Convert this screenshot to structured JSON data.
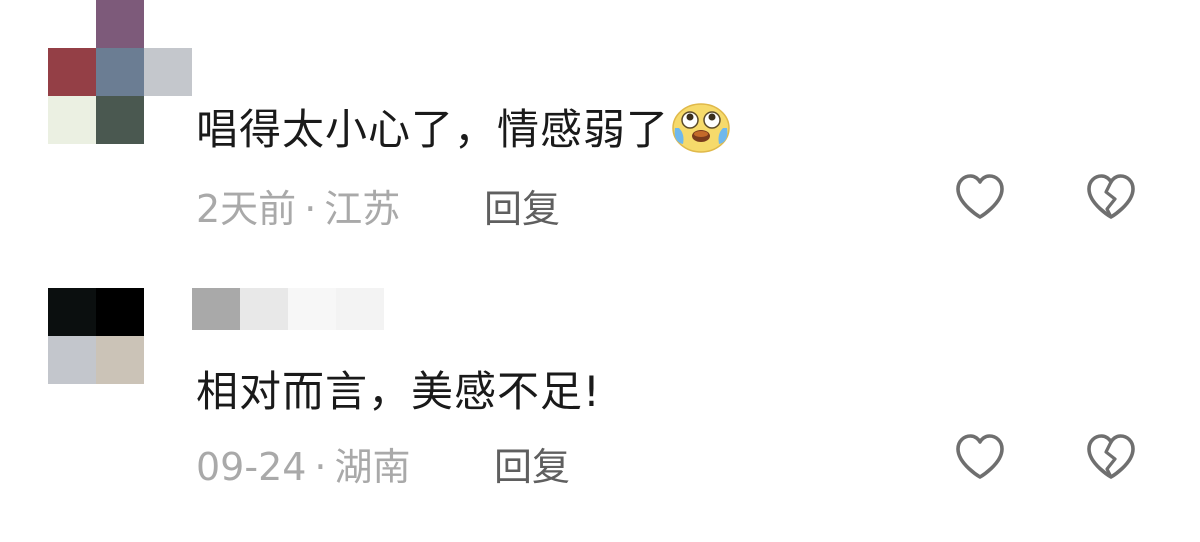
{
  "comments": [
    {
      "text": "唱得太小心了，情感弱了",
      "emoji_icon": "tears-of-joy-emoji-icon",
      "time": "2天前",
      "separator": "·",
      "location": "江苏",
      "reply_label": "回复",
      "avatar_colors": [
        "#ffffff",
        "#7d5a7a",
        "#ffffff",
        "#943f46",
        "#6b7d93",
        "#c4c7cc",
        "#ebf0e2",
        "#4a5850",
        "#ffffff"
      ]
    },
    {
      "text": "相对而言，美感不足!",
      "time": "09-24",
      "separator": "·",
      "location": "湖南",
      "reply_label": "回复",
      "avatar_colors": [
        "#0b0f0f",
        "#000000",
        "#ffffff",
        "#c3c6cc",
        "#cbc3b7",
        "#ffffff"
      ]
    }
  ],
  "icons": {
    "like": "heart-outline-icon",
    "dislike": "broken-heart-icon"
  }
}
